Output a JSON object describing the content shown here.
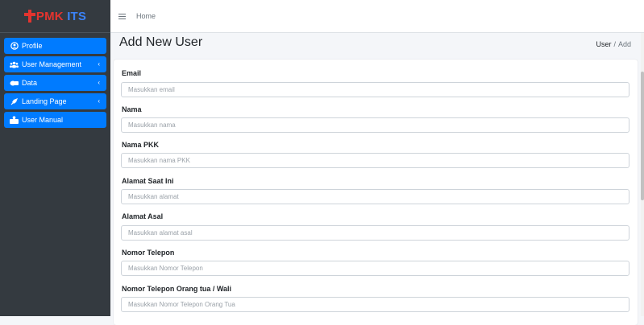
{
  "brand": {
    "part1": "PMK",
    "part2": "ITS",
    "accent": "#e3342f",
    "accent2": "#3b82f6"
  },
  "sidebar": {
    "items": [
      {
        "label": "Profile",
        "icon": "user-circle-icon",
        "has_chevron": false
      },
      {
        "label": "User Management",
        "icon": "users-icon",
        "has_chevron": true
      },
      {
        "label": "Data",
        "icon": "database-icon",
        "has_chevron": true
      },
      {
        "label": "Landing Page",
        "icon": "rocket-icon",
        "has_chevron": true
      },
      {
        "label": "User Manual",
        "icon": "book-user-icon",
        "has_chevron": false
      }
    ],
    "chevron": "‹",
    "background": "#343a40",
    "item_color": "#007bff"
  },
  "topbar": {
    "home_label": "Home"
  },
  "page": {
    "title": "Add New User",
    "breadcrumb": {
      "parent": "User",
      "separator": "/",
      "current": "Add"
    }
  },
  "form": {
    "fields": [
      {
        "label": "Email",
        "placeholder": "Masukkan email"
      },
      {
        "label": "Nama",
        "placeholder": "Masukkan nama"
      },
      {
        "label": "Nama PKK",
        "placeholder": "Masukkan nama PKK"
      },
      {
        "label": "Alamat Saat Ini",
        "placeholder": "Masukkan alamat"
      },
      {
        "label": "Alamat Asal",
        "placeholder": "Masukkan alamat asal"
      },
      {
        "label": "Nomor Telepon",
        "placeholder": "Masukkan Nomor Telepon"
      },
      {
        "label": "Nomor Telepon Orang tua / Wali",
        "placeholder": "Masukkan Nomor Telepon Orang Tua"
      }
    ]
  }
}
